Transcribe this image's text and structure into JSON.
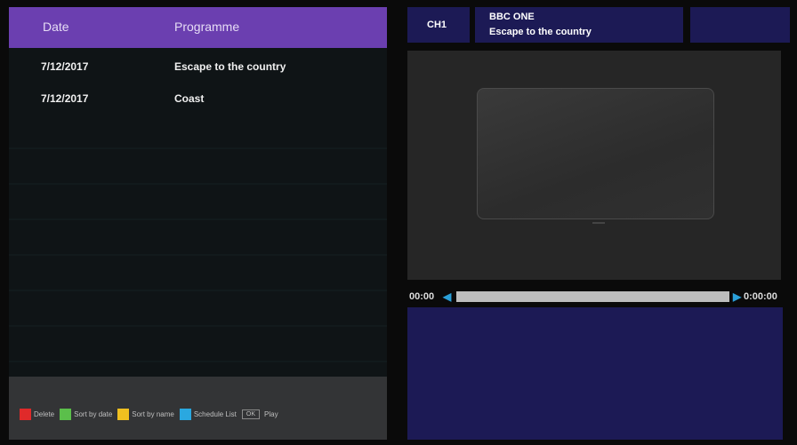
{
  "list": {
    "header": {
      "date_label": "Date",
      "programme_label": "Programme"
    },
    "rows": [
      {
        "date": "7/12/2017",
        "programme": "Escape to the country"
      },
      {
        "date": "7/12/2017",
        "programme": "Coast"
      }
    ]
  },
  "footer": {
    "delete": "Delete",
    "sort_date": "Sort by date",
    "sort_name": "Sort by name",
    "schedule": "Schedule List",
    "ok": "OK",
    "play": "Play",
    "colors": {
      "red": "#e02a2a",
      "green": "#5bbf4b",
      "yellow": "#f0c020",
      "blue": "#2aa8e0"
    }
  },
  "channel": {
    "number": "CH1",
    "name": "BBC ONE",
    "programme": "Escape to the country"
  },
  "playback": {
    "current_time": "00:00",
    "total_time": "0:00:00",
    "progress": 0
  },
  "colors": {
    "accent": "#6b3fb0",
    "panel_blue": "#1c1a55"
  }
}
